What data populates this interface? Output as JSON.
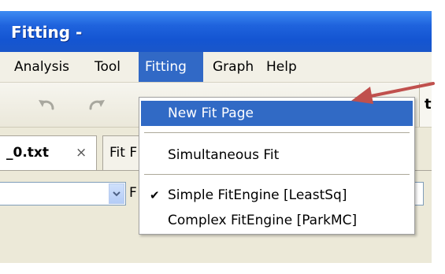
{
  "window": {
    "title": "Fitting -"
  },
  "menubar": {
    "items": [
      {
        "label": "Analysis"
      },
      {
        "label": "Tool"
      },
      {
        "label": "Fitting",
        "active": true
      },
      {
        "label": "Graph"
      },
      {
        "label": "Help"
      }
    ]
  },
  "toolbar": {
    "buttons": [
      {
        "icon": "undo-icon"
      },
      {
        "icon": "redo-icon"
      }
    ],
    "right_fragment": "t"
  },
  "tabs": [
    {
      "label": "_0.txt",
      "close": "×",
      "active": true
    },
    {
      "label": "Fit F",
      "active": false
    }
  ],
  "content": {
    "label_fragment": "F"
  },
  "dropdown": {
    "items": [
      {
        "label": "New Fit Page",
        "highlighted": true
      },
      {
        "label": "Simultaneous Fit"
      },
      {
        "label": "Simple FitEngine  [LeastSq]",
        "checked": true
      },
      {
        "label": "Complex FitEngine [ParkMC]"
      }
    ]
  },
  "annotation": {
    "arrow_color": "#c0504d"
  },
  "colors": {
    "titlebar": "#1455d2",
    "menu_highlight": "#316ac5",
    "window_bg": "#ece9d8"
  }
}
